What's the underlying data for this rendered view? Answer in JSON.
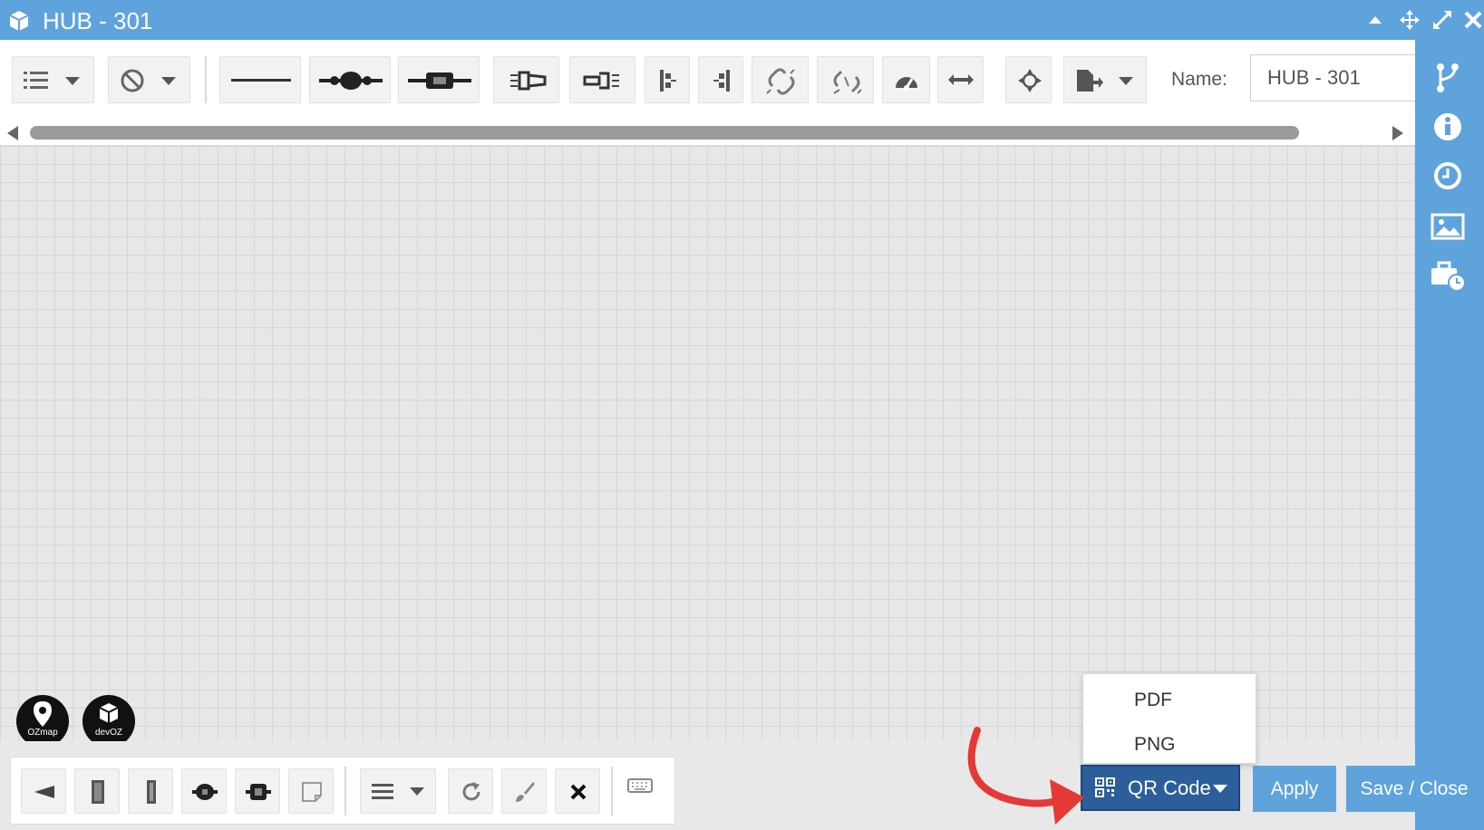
{
  "window": {
    "title": "HUB - 301",
    "controls": [
      "caret-up-icon",
      "move-icon",
      "expand-icon",
      "close-icon"
    ]
  },
  "toolbar": {
    "name_label": "Name:",
    "name_value": "HUB - 301",
    "buttons": [
      "list-menu-icon",
      "block-menu-icon",
      "cable-line-icon",
      "splice-icon",
      "connector-icon",
      "splitter-in-icon",
      "splitter-out-icon",
      "align-left-icon",
      "align-right-icon",
      "link-icon",
      "unlink-icon",
      "gauge-icon",
      "swap-horizontal-icon",
      "center-icon",
      "export-icon"
    ]
  },
  "sidebar": {
    "items": [
      "branch-icon",
      "info-icon",
      "history-icon",
      "image-icon",
      "toolbox-clock-icon"
    ]
  },
  "canvas": {
    "logos": [
      {
        "name": "ozmap-logo",
        "label": "OZmap"
      },
      {
        "name": "devoz-logo",
        "label": "devOZ"
      }
    ]
  },
  "bottom_toolbar": {
    "buttons": [
      "terminal-icon",
      "panel-icon",
      "rack-icon",
      "closure-icon",
      "box-icon",
      "note-icon",
      "lines-menu-icon",
      "rotate-icon",
      "brush-icon",
      "delete-icon",
      "keyboard-icon"
    ]
  },
  "actions": {
    "qr_code_label": "QR Code",
    "apply_label": "Apply",
    "save_close_label": "Save / Close"
  },
  "dropdown": {
    "options": [
      "PDF",
      "PNG"
    ]
  },
  "colors": {
    "accent": "#5fa3dd",
    "qr_button": "#2c5f9a",
    "annotation_arrow": "#e53935"
  }
}
